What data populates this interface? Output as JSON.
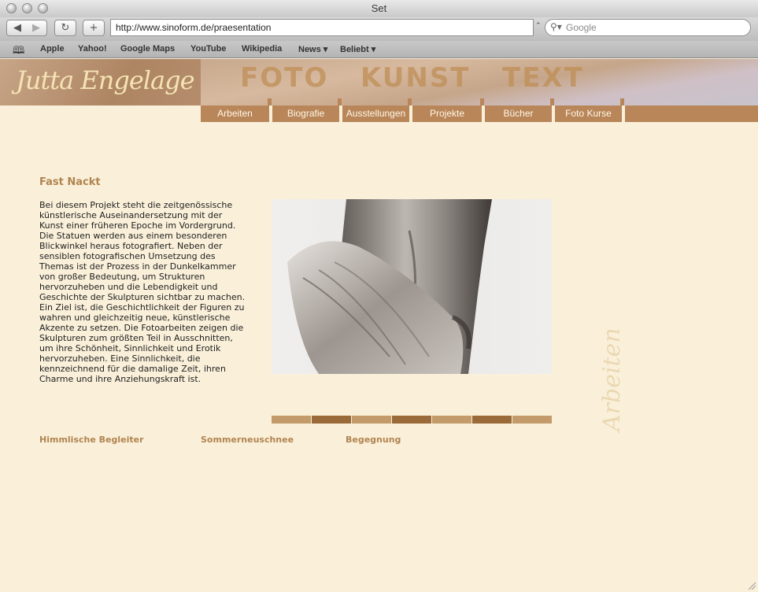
{
  "window": {
    "title": "Set"
  },
  "toolbar": {
    "url": "http://www.sinoform.de/praesentation",
    "search_placeholder": "Google"
  },
  "bookmarks": [
    {
      "label": "Apple"
    },
    {
      "label": "Yahoo!"
    },
    {
      "label": "Google Maps"
    },
    {
      "label": "YouTube"
    },
    {
      "label": "Wikipedia"
    },
    {
      "label": "News ▾"
    },
    {
      "label": "Beliebt ▾"
    }
  ],
  "site": {
    "logo": "Jutta Engelage",
    "banner_words": [
      "FOTO",
      "KUNST",
      "TEXT"
    ],
    "nav": [
      "Arbeiten",
      "Biografie",
      "Ausstellungen",
      "Projekte",
      "Bücher",
      "Foto Kurse"
    ]
  },
  "content": {
    "title": "Fast Nackt",
    "paragraphs": [
      "Bei diesem Projekt steht die zeitgenössische künstlerische Auseinandersetzung mit der Kunst einer früheren Epoche im Vordergrund.",
      "Die Statuen werden aus einem besonderen Blickwinkel heraus fotografiert. Neben der sensiblen fotografischen Umsetzung des Themas ist der Prozess in der Dunkelkammer von großer Bedeutung, um Strukturen hervorzuheben und die Lebendigkeit und Geschichte der Skulpturen sichtbar zu machen.",
      "Ein Ziel ist, die Geschichtlichkeit der Figuren zu wahren und gleichzeitig neue, künstlerische Akzente zu setzen. Die Fotoarbeiten zeigen die Skulpturen zum größten Teil in Ausschnitten, um ihre Schönheit, Sinnlichkeit und Erotik hervorzuheben. Eine Sinnlichkeit, die kennzeichnend für die damalige Zeit, ihren Charme und ihre Anziehungskraft ist."
    ],
    "side_label": "Arbeiten",
    "thumb_colors": [
      "#c39b6a",
      "#9a6a38",
      "#c39b6a",
      "#9a6a38",
      "#c39b6a",
      "#9a6a38",
      "#c39b6a"
    ],
    "related_links": [
      "Himmlische Begleiter",
      "Sommerneuschnee",
      "Begegnung"
    ]
  },
  "colors": {
    "page_bg": "#faf0da",
    "nav_bg": "#b9865a",
    "accent": "#b08450"
  }
}
